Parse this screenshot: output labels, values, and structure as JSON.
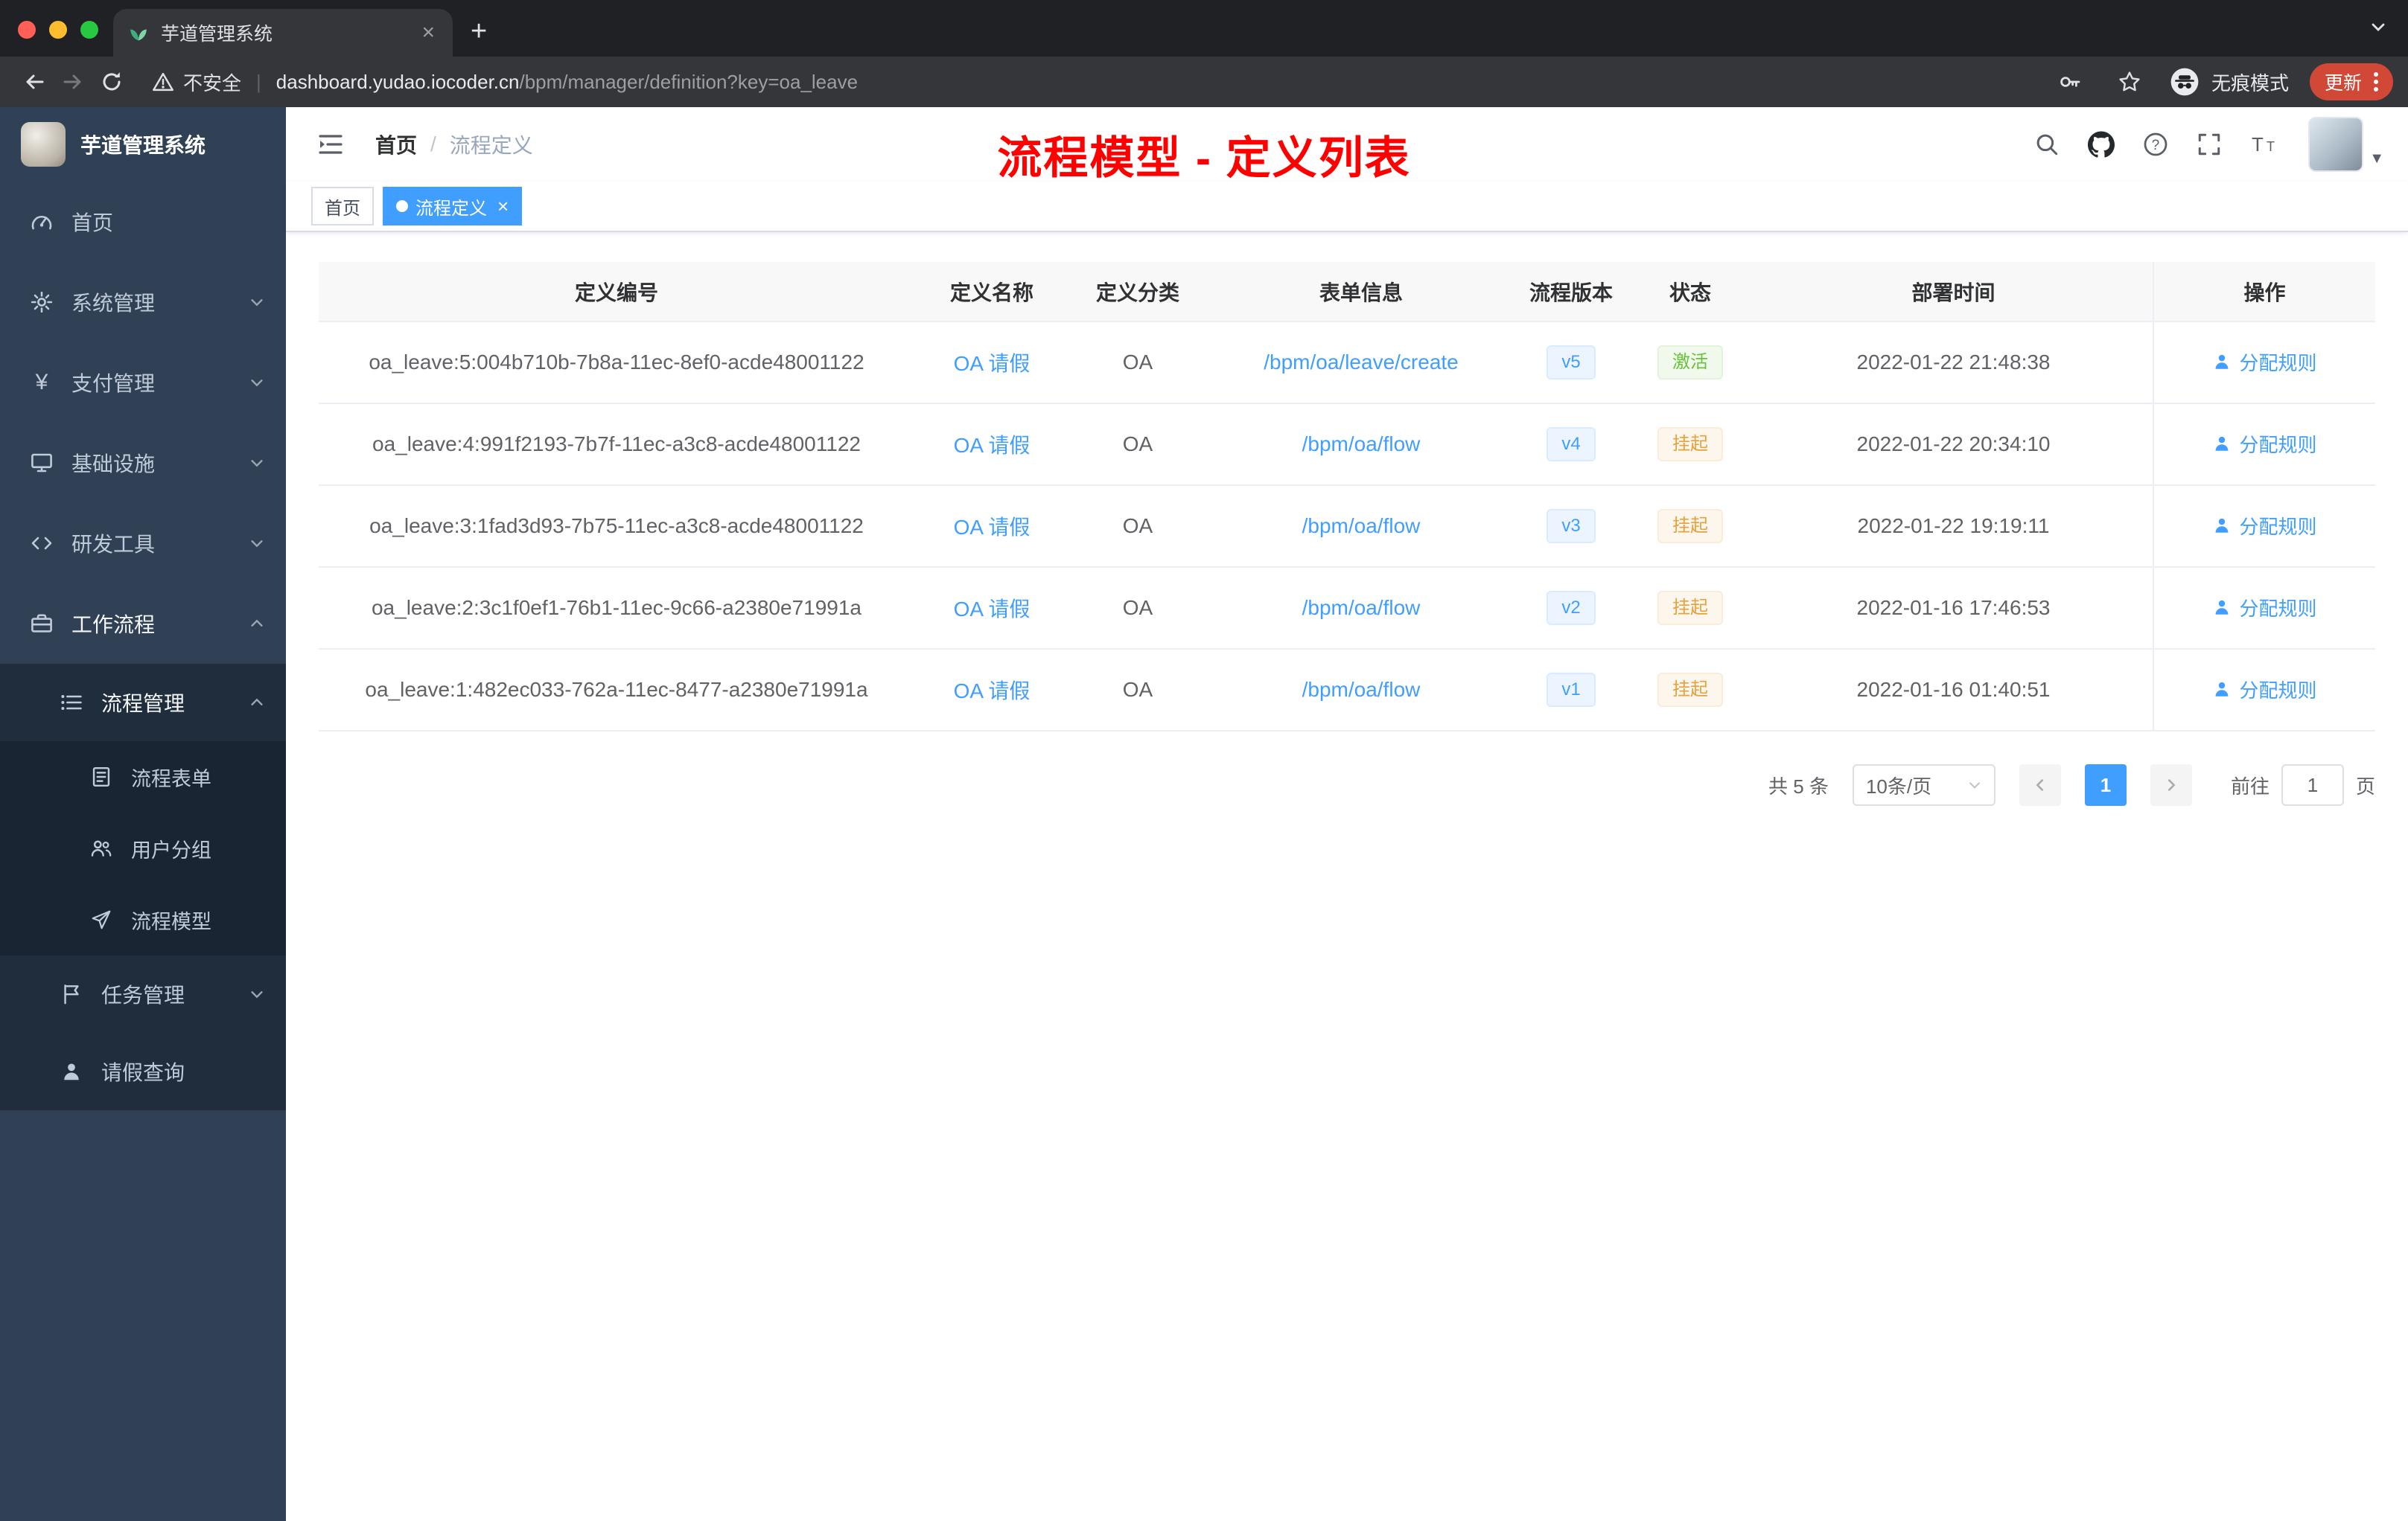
{
  "colors": {
    "accent": "#409eff",
    "success": "#67c23a",
    "warning": "#e6a23c",
    "annotation_red": "#ff0000",
    "sidebar_bg": "#304156",
    "active_tag_bg": "#409eff"
  },
  "browser": {
    "tab_title": "芋道管理系统",
    "security_label": "不安全",
    "url_host": "dashboard.yudao.iocoder.cn",
    "url_path": "/bpm/manager/definition?key=oa_leave",
    "incognito_label": "无痕模式",
    "update_label": "更新"
  },
  "sidebar": {
    "logo_title": "芋道管理系统",
    "items": [
      {
        "label": "首页",
        "icon": "dashboard-icon"
      },
      {
        "label": "系统管理",
        "icon": "gear-icon"
      },
      {
        "label": "支付管理",
        "icon": "yen-icon"
      },
      {
        "label": "基础设施",
        "icon": "infrastructure-icon"
      },
      {
        "label": "研发工具",
        "icon": "dev-tools-icon"
      },
      {
        "label": "工作流程",
        "icon": "workflow-icon"
      }
    ],
    "submenu": {
      "process": {
        "label": "流程管理",
        "children": [
          {
            "label": "流程表单",
            "icon": "form-icon"
          },
          {
            "label": "用户分组",
            "icon": "user-group-icon"
          },
          {
            "label": "流程模型",
            "icon": "send-icon"
          }
        ]
      },
      "task": {
        "label": "任务管理",
        "icon": "flag-icon"
      },
      "leave": {
        "label": "请假查询",
        "icon": "user-icon"
      }
    }
  },
  "header": {
    "breadcrumb_home": "首页",
    "breadcrumb_current": "流程定义",
    "annotation": "流程模型 - 定义列表"
  },
  "tags": {
    "home": "首页",
    "active": "流程定义"
  },
  "table": {
    "columns": {
      "id": "定义编号",
      "name": "定义名称",
      "category": "定义分类",
      "form": "表单信息",
      "version": "流程版本",
      "status": "状态",
      "deploy_time": "部署时间",
      "action": "操作"
    },
    "rows": [
      {
        "id": "oa_leave:5:004b710b-7b8a-11ec-8ef0-acde48001122",
        "name": "OA 请假",
        "category": "OA",
        "form": "/bpm/oa/leave/create",
        "version": "v5",
        "status": "激活",
        "deploy_time": "2022-01-22 21:48:38",
        "action": "分配规则"
      },
      {
        "id": "oa_leave:4:991f2193-7b7f-11ec-a3c8-acde48001122",
        "name": "OA 请假",
        "category": "OA",
        "form": "/bpm/oa/flow",
        "version": "v4",
        "status": "挂起",
        "deploy_time": "2022-01-22 20:34:10",
        "action": "分配规则"
      },
      {
        "id": "oa_leave:3:1fad3d93-7b75-11ec-a3c8-acde48001122",
        "name": "OA 请假",
        "category": "OA",
        "form": "/bpm/oa/flow",
        "version": "v3",
        "status": "挂起",
        "deploy_time": "2022-01-22 19:19:11",
        "action": "分配规则"
      },
      {
        "id": "oa_leave:2:3c1f0ef1-76b1-11ec-9c66-a2380e71991a",
        "name": "OA 请假",
        "category": "OA",
        "form": "/bpm/oa/flow",
        "version": "v2",
        "status": "挂起",
        "deploy_time": "2022-01-16 17:46:53",
        "action": "分配规则"
      },
      {
        "id": "oa_leave:1:482ec033-762a-11ec-8477-a2380e71991a",
        "name": "OA 请假",
        "category": "OA",
        "form": "/bpm/oa/flow",
        "version": "v1",
        "status": "挂起",
        "deploy_time": "2022-01-16 01:40:51",
        "action": "分配规则"
      }
    ]
  },
  "pagination": {
    "total": "共 5 条",
    "page_size": "10条/页",
    "current_page": "1",
    "goto_label": "前往",
    "goto_value": "1",
    "goto_unit": "页"
  }
}
